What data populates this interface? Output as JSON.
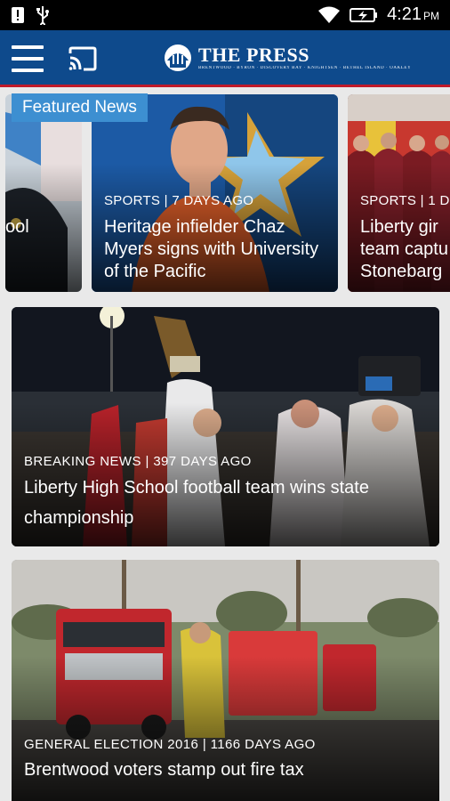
{
  "status_bar": {
    "time": "4:21",
    "ampm": "PM"
  },
  "app_bar": {
    "logo_title": "THE PRESS",
    "logo_subtitle": "BRENTWOOD · BYRON · DISCOVERY BAY · KNIGHTSEN · BETHEL ISLAND · OAKLEY",
    "brand_color": "#0e4a8c",
    "accent_color": "#c01a2a"
  },
  "featured": {
    "label": "Featured News",
    "cards": [
      {
        "meta": "",
        "headline": "ool"
      },
      {
        "meta": "SPORTS | 7 DAYS AGO",
        "headline": "Heritage infielder Chaz Myers signs with University of the Pacific"
      },
      {
        "meta": "SPORTS | 1 D",
        "headline": "Liberty gir team captu Stonebarg"
      }
    ]
  },
  "stories": [
    {
      "meta": "BREAKING NEWS | 397 DAYS AGO",
      "headline": "Liberty High School football team wins state championship"
    },
    {
      "meta": "GENERAL ELECTION 2016 | 1166 DAYS AGO",
      "headline": "Brentwood voters stamp out fire tax"
    }
  ],
  "icons": [
    "notification-icon",
    "usb-icon",
    "wifi-icon",
    "battery-charging-icon",
    "menu-icon",
    "cast-icon",
    "press-logo-icon"
  ]
}
